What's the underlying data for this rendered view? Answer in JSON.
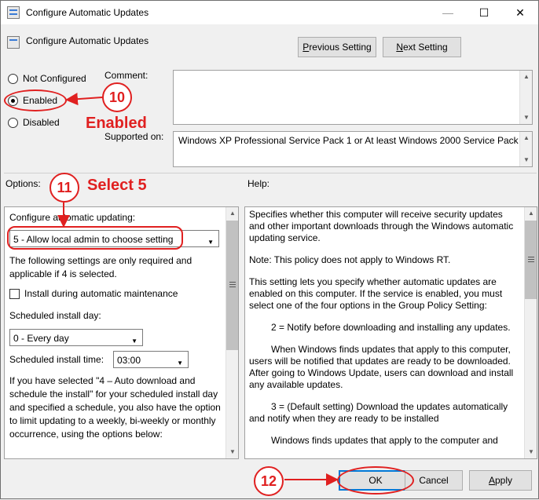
{
  "window": {
    "title": "Configure Automatic Updates",
    "controls": {
      "minimize": "—",
      "maximize": "☐",
      "close": "✕"
    }
  },
  "header": {
    "policy_title": "Configure Automatic Updates",
    "previous_label": "Previous Setting",
    "next_label": "Next Setting"
  },
  "state": {
    "not_configured": "Not Configured",
    "enabled": "Enabled",
    "disabled": "Disabled",
    "selected": "Enabled"
  },
  "comment": {
    "label": "Comment:",
    "value": ""
  },
  "supported": {
    "label": "Supported on:",
    "value": "Windows XP Professional Service Pack 1 or At least Windows 2000 Service Pack 3"
  },
  "options": {
    "label": "Options:",
    "configure_label": "Configure automatic updating:",
    "configure_value": "5 - Allow local admin to choose setting",
    "note": "The following settings are only required and applicable if 4 is selected.",
    "install_maintenance": "Install during automatic maintenance",
    "install_day_label": "Scheduled install day:",
    "install_day_value": "0 - Every day",
    "install_time_label": "Scheduled install time:",
    "install_time_value": "03:00",
    "extra_text": "If you have selected \"4 – Auto download and schedule the install\" for your scheduled install day and specified a schedule, you also have the option to limit updating to a weekly, bi-weekly or monthly occurrence, using the options below:"
  },
  "help": {
    "label": "Help:",
    "paragraphs": [
      "Specifies whether this computer will receive security updates and other important downloads through the Windows automatic updating service.",
      "Note: This policy does not apply to Windows RT.",
      "This setting lets you specify whether automatic updates are enabled on this computer. If the service is enabled, you must select one of the four options in the Group Policy Setting:",
      "2 = Notify before downloading and installing any updates.",
      "When Windows finds updates that apply to this computer, users will be notified that updates are ready to be downloaded. After going to Windows Update, users can download and install any available updates.",
      "3 = (Default setting) Download the updates automatically and notify when they are ready to be installed",
      "Windows finds updates that apply to the computer and"
    ]
  },
  "footer": {
    "ok": "OK",
    "cancel": "Cancel",
    "apply": "Apply"
  },
  "annotations": {
    "step10": "10",
    "step10_text": "Enabled",
    "step11": "11",
    "step11_text": "Select 5",
    "step12": "12",
    "color": "#e02020"
  }
}
